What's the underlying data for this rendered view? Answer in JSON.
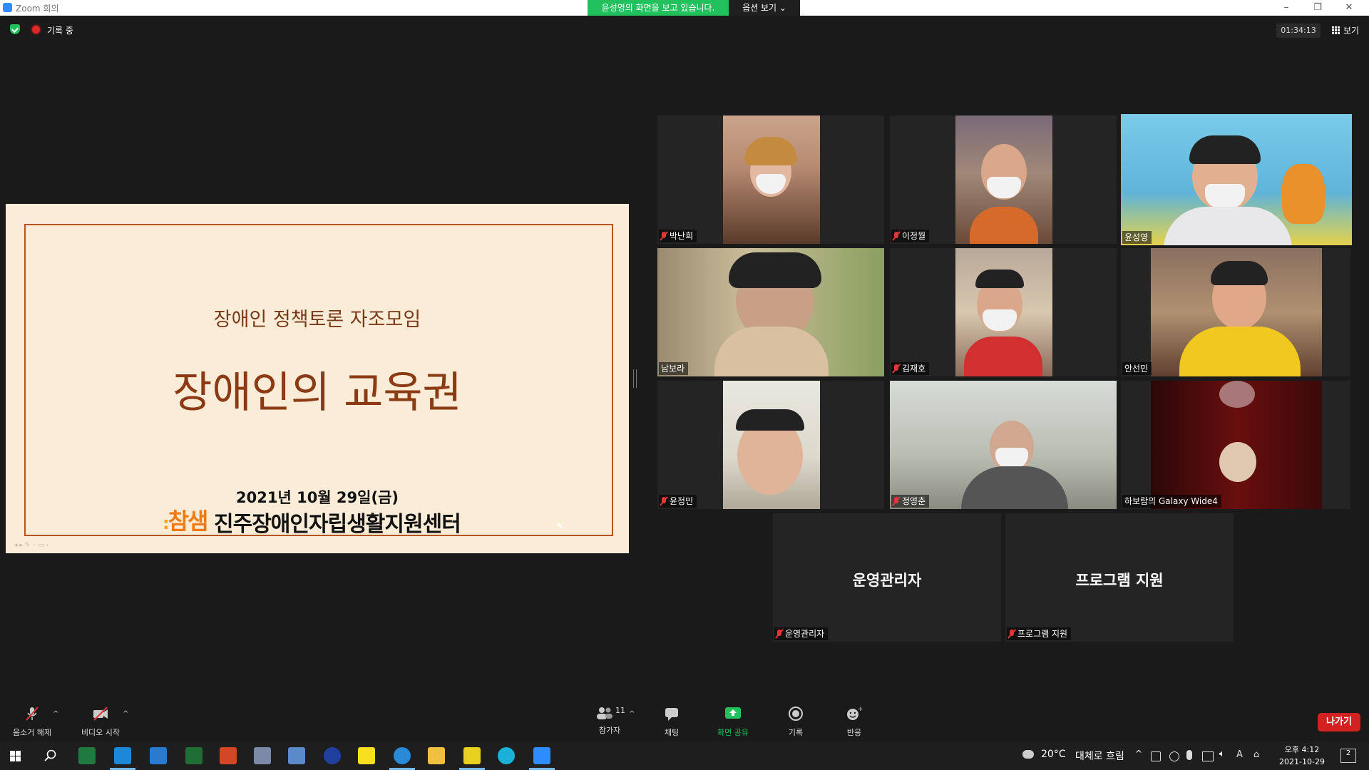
{
  "window": {
    "title": "Zoom 회의",
    "share_banner": "윤성영의 화면을 보고 있습니다.",
    "view_options": "옵션 보기 ⌄",
    "controls": [
      "–",
      "❐",
      "✕"
    ]
  },
  "meeting": {
    "recording_label": "기록 중",
    "elapsed_time": "01:34:13",
    "view_label": "보기"
  },
  "slide": {
    "subtitle": "장애인 정책토론 자조모임",
    "title": "장애인의 교육권",
    "date": "2021년 10월 29일(금)",
    "logo_text": "참샘",
    "org_name": "진주장애인자립생활지원센터"
  },
  "participants": [
    {
      "name": "박난희",
      "muted": true,
      "video": true
    },
    {
      "name": "이정월",
      "muted": true,
      "video": true
    },
    {
      "name": "윤성영",
      "muted": false,
      "video": true,
      "active_speaker": true
    },
    {
      "name": "남보라",
      "muted": false,
      "video": true
    },
    {
      "name": "김재호",
      "muted": true,
      "video": true
    },
    {
      "name": "안선민",
      "muted": false,
      "video": true
    },
    {
      "name": "윤정민",
      "muted": true,
      "video": true
    },
    {
      "name": "정영춘",
      "muted": true,
      "video": true
    },
    {
      "name": "하보람의 Galaxy Wide4",
      "muted": false,
      "video": true
    },
    {
      "name": "운영관리자",
      "display": "운영관리자",
      "muted": true,
      "video": false
    },
    {
      "name": "프로그램 지원",
      "display": "프로그램 지원",
      "muted": true,
      "video": false
    }
  ],
  "toolbar": {
    "unmute": "음소거 해제",
    "start_video": "비디오 시작",
    "participants": "참가자",
    "participants_count": "11",
    "chat": "채팅",
    "share_screen": "화면 공유",
    "record": "기록",
    "reactions": "반응",
    "leave": "나가기"
  },
  "taskbar": {
    "weather_temp": "20°C",
    "weather_desc": "대체로 흐림",
    "time": "오후 4:12",
    "date": "2021-10-29",
    "notifications": "2"
  },
  "colors": {
    "share_green": "#23c15e",
    "active_speaker": "#e8e040",
    "leave_red": "#d32020",
    "slide_bg": "#fbecd8",
    "slide_accent": "#b5551f"
  }
}
